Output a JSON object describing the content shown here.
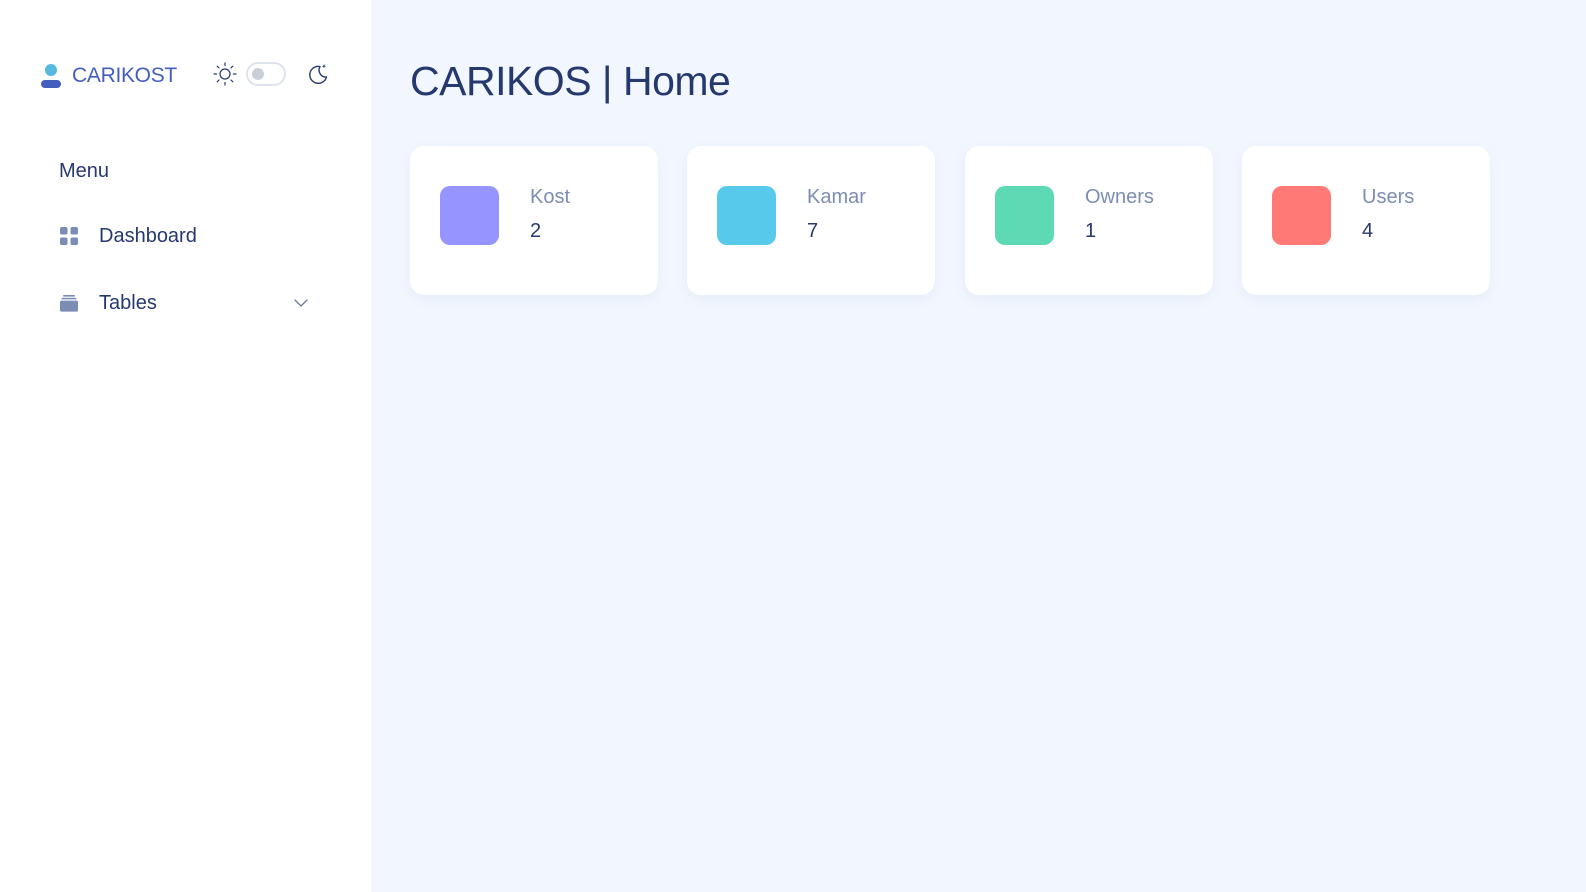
{
  "brand": {
    "name": "CARIKOST",
    "accent_color": "#435ebe"
  },
  "theme_toggle": {
    "light_icon": "sun-icon",
    "dark_icon": "moon-icon",
    "dark_mode": false
  },
  "sidebar": {
    "menu_title": "Menu",
    "items": [
      {
        "label": "Dashboard",
        "icon": "grid-icon"
      },
      {
        "label": "Tables",
        "icon": "stack-icon",
        "expandable": true
      }
    ]
  },
  "main": {
    "title": "CARIKOS | Home",
    "stats": [
      {
        "label": "Kost",
        "value": "2",
        "color": "#9694ff"
      },
      {
        "label": "Kamar",
        "value": "7",
        "color": "#57caeb"
      },
      {
        "label": "Owners",
        "value": "1",
        "color": "#5ddab4"
      },
      {
        "label": "Users",
        "value": "4",
        "color": "#ff7976"
      }
    ]
  }
}
